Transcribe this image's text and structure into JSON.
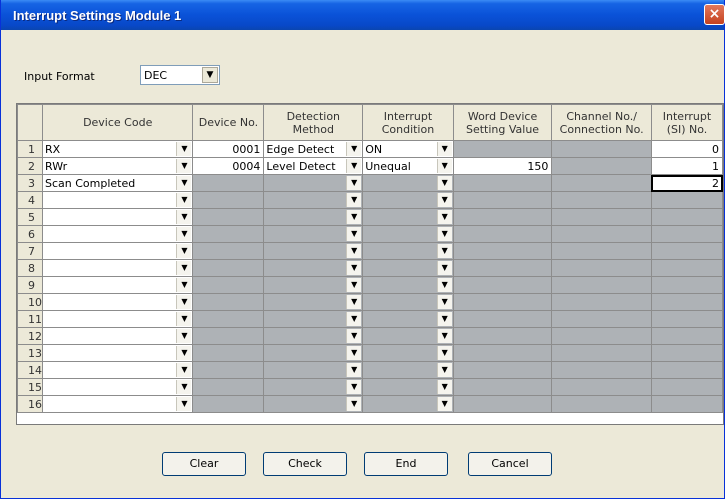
{
  "window": {
    "title": "Interrupt Settings Module 1",
    "close_glyph": "×"
  },
  "input_format": {
    "label": "Input Format",
    "value": "DEC"
  },
  "table": {
    "headers": {
      "device_code": "Device Code",
      "device_no": "Device No.",
      "detection_method_1": "Detection",
      "detection_method_2": "Method",
      "interrupt_condition_1": "Interrupt",
      "interrupt_condition_2": "Condition",
      "word_device_1": "Word Device",
      "word_device_2": "Setting Value",
      "channel_1": "Channel No./",
      "channel_2": "Connection No.",
      "interrupt_si_1": "Interrupt",
      "interrupt_si_2": "(SI) No."
    },
    "rows": [
      {
        "n": "1",
        "device_code": "RX",
        "device_no": "0001",
        "detection": "Edge Detect",
        "condition": "ON",
        "word_value": "",
        "si": "0"
      },
      {
        "n": "2",
        "device_code": "RWr",
        "device_no": "0004",
        "detection": "Level Detect",
        "condition": "Unequal",
        "word_value": "150",
        "si": "1"
      },
      {
        "n": "3",
        "device_code": "Scan Completed",
        "device_no": "",
        "detection": "",
        "condition": "",
        "word_value": "",
        "si": "2"
      },
      {
        "n": "4",
        "device_code": "",
        "device_no": "",
        "detection": "",
        "condition": "",
        "word_value": "",
        "si": ""
      },
      {
        "n": "5",
        "device_code": "",
        "device_no": "",
        "detection": "",
        "condition": "",
        "word_value": "",
        "si": ""
      },
      {
        "n": "6",
        "device_code": "",
        "device_no": "",
        "detection": "",
        "condition": "",
        "word_value": "",
        "si": ""
      },
      {
        "n": "7",
        "device_code": "",
        "device_no": "",
        "detection": "",
        "condition": "",
        "word_value": "",
        "si": ""
      },
      {
        "n": "8",
        "device_code": "",
        "device_no": "",
        "detection": "",
        "condition": "",
        "word_value": "",
        "si": ""
      },
      {
        "n": "9",
        "device_code": "",
        "device_no": "",
        "detection": "",
        "condition": "",
        "word_value": "",
        "si": ""
      },
      {
        "n": "10",
        "device_code": "",
        "device_no": "",
        "detection": "",
        "condition": "",
        "word_value": "",
        "si": ""
      },
      {
        "n": "11",
        "device_code": "",
        "device_no": "",
        "detection": "",
        "condition": "",
        "word_value": "",
        "si": ""
      },
      {
        "n": "12",
        "device_code": "",
        "device_no": "",
        "detection": "",
        "condition": "",
        "word_value": "",
        "si": ""
      },
      {
        "n": "13",
        "device_code": "",
        "device_no": "",
        "detection": "",
        "condition": "",
        "word_value": "",
        "si": ""
      },
      {
        "n": "14",
        "device_code": "",
        "device_no": "",
        "detection": "",
        "condition": "",
        "word_value": "",
        "si": ""
      },
      {
        "n": "15",
        "device_code": "",
        "device_no": "",
        "detection": "",
        "condition": "",
        "word_value": "",
        "si": ""
      },
      {
        "n": "16",
        "device_code": "",
        "device_no": "",
        "detection": "",
        "condition": "",
        "word_value": "",
        "si": ""
      }
    ]
  },
  "buttons": {
    "clear": "Clear",
    "check": "Check",
    "end": "End",
    "cancel": "Cancel"
  },
  "dropdown_arrow": "▼"
}
